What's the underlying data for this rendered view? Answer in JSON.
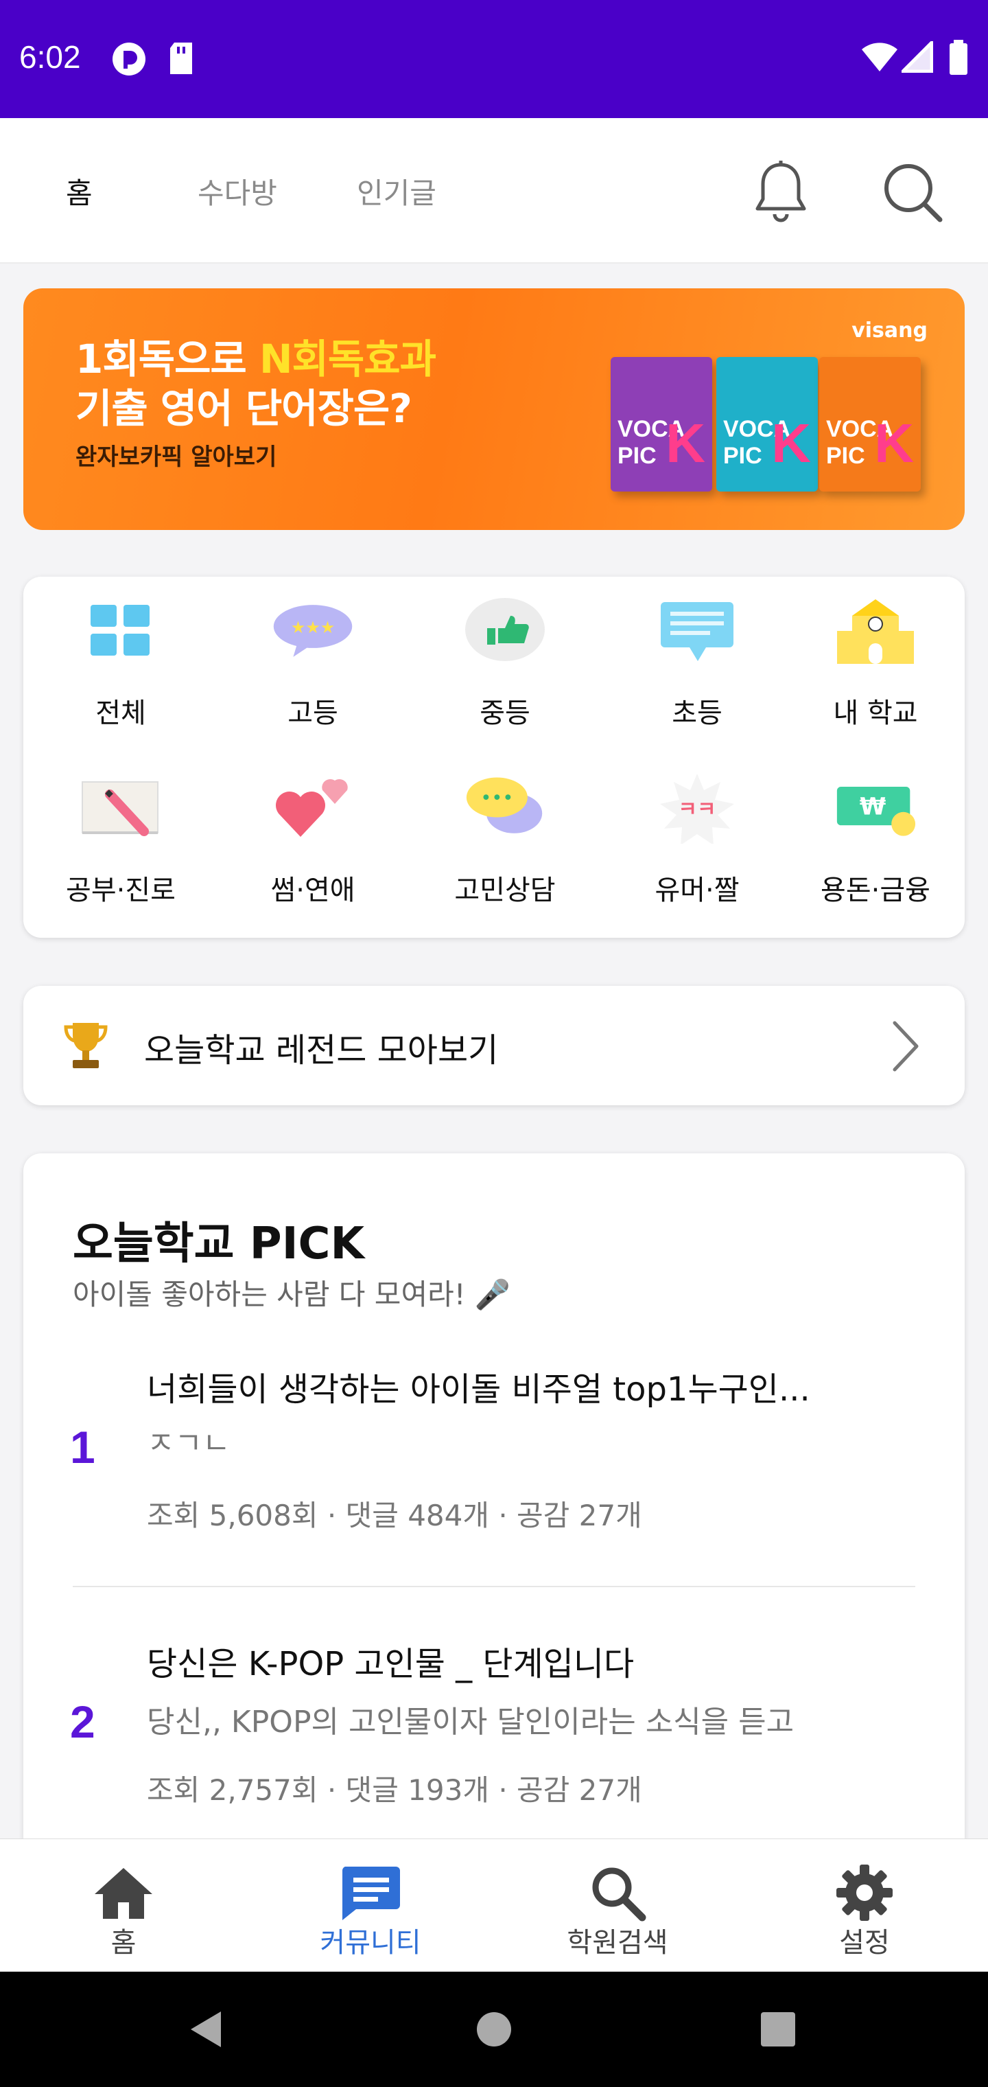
{
  "status_bar": {
    "time": "6:02",
    "bg_color": "#4a00c8"
  },
  "top_bar": {
    "tabs": [
      {
        "label": "홈",
        "active": true
      },
      {
        "label": "수다방",
        "active": false
      },
      {
        "label": "인기글",
        "active": false
      }
    ],
    "icons": [
      "bell-icon",
      "search-icon"
    ]
  },
  "banner": {
    "line1_part1": "1회독으로 ",
    "line1_highlight": "N회독효과",
    "line2": "기출 영어 단어장은?",
    "line3": "완자보카픽 알아보기",
    "brand": "visang",
    "books": [
      "VOCA PIC",
      "VOCA PIC",
      "VOCA PIC"
    ]
  },
  "categories": [
    {
      "label": "전체",
      "icon": "grid-icon"
    },
    {
      "label": "고등",
      "icon": "stars-bubble-icon"
    },
    {
      "label": "중등",
      "icon": "thumbs-up-icon"
    },
    {
      "label": "초등",
      "icon": "message-icon"
    },
    {
      "label": "내 학교",
      "icon": "school-icon"
    },
    {
      "label": "공부·진로",
      "icon": "notebook-pencil-icon"
    },
    {
      "label": "썸·연애",
      "icon": "hearts-icon"
    },
    {
      "label": "고민상담",
      "icon": "chat-bubbles-icon"
    },
    {
      "label": "유머·짤",
      "icon": "laugh-burst-icon"
    },
    {
      "label": "용돈·금융",
      "icon": "money-icon"
    }
  ],
  "legend": {
    "label": "오늘학교 레전드 모아보기",
    "icon": "trophy-icon"
  },
  "pick": {
    "title": "오늘학교 PICK",
    "subtitle": "아이돌 좋아하는 사람 다 모여라! 🎤",
    "posts": [
      {
        "rank": "1",
        "title": "너희들이 생각하는 아이돌 비주얼 top1누구인...",
        "preview": "ㅈㄱㄴ",
        "meta": "조회 5,608회 · 댓글 484개 · 공감 27개"
      },
      {
        "rank": "2",
        "title": "당신은 K-POP 고인물 _ 단계입니다",
        "preview": "당신,, KPOP의 고인물이자 달인이라는 소식을 듣고",
        "meta": "조회 2,757회 · 댓글 193개 · 공감 27개"
      }
    ]
  },
  "bottom_nav": [
    {
      "label": "홈",
      "icon": "home-icon",
      "active": false
    },
    {
      "label": "커뮤니티",
      "icon": "community-icon",
      "active": true
    },
    {
      "label": "학원검색",
      "icon": "search-icon",
      "active": false
    },
    {
      "label": "설정",
      "icon": "gear-icon",
      "active": false
    }
  ],
  "colors": {
    "accent": "#5b16d8",
    "banner": "#ff8a1f",
    "nav_active": "#2f6fd6"
  }
}
